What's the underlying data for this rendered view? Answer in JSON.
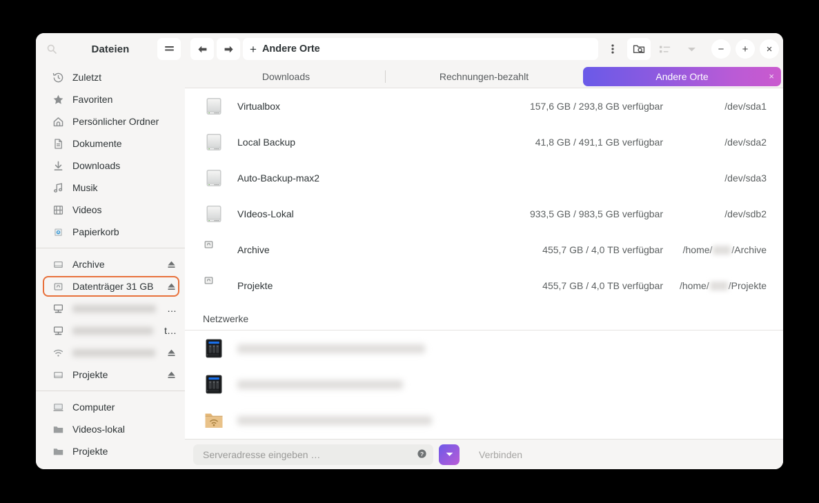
{
  "app": {
    "title": "Dateien",
    "search_icon": "search-icon",
    "menu_icon": "hamburger-menu-icon"
  },
  "toolbar": {
    "back_icon": "arrow-left-icon",
    "forward_icon": "arrow-right-icon",
    "path_plus": "+",
    "path_label": "Andere Orte",
    "kebab_icon": "vertical-dots-icon",
    "folder_search_icon": "folder-search-icon",
    "list_view_icon": "list-view-icon",
    "view_dropdown_icon": "chevron-down-icon",
    "minimize_label": "−",
    "maximize_label": "+",
    "close_label": "×"
  },
  "tabs": [
    {
      "label": "Downloads",
      "active": false
    },
    {
      "label": "Rechnungen-bezahlt",
      "active": false
    },
    {
      "label": "Andere Orte",
      "active": true,
      "close_label": "×"
    }
  ],
  "sidebar": {
    "groups": [
      {
        "items": [
          {
            "label": "Zuletzt",
            "icon": "history-icon"
          },
          {
            "label": "Favoriten",
            "icon": "star-icon"
          },
          {
            "label": "Persönlicher Ordner",
            "icon": "home-icon"
          },
          {
            "label": "Dokumente",
            "icon": "document-icon"
          },
          {
            "label": "Downloads",
            "icon": "download-icon"
          },
          {
            "label": "Musik",
            "icon": "music-note-icon"
          },
          {
            "label": "Videos",
            "icon": "film-icon"
          },
          {
            "label": "Papierkorb",
            "icon": "trash-icon"
          }
        ]
      },
      {
        "items": [
          {
            "label": "Archive",
            "icon": "drive-icon",
            "eject": true
          },
          {
            "label": "Datenträger 31 GB",
            "icon": "removable-drive-icon",
            "eject": true,
            "highlighted": true
          },
          {
            "label": "",
            "icon": "server-icon",
            "blurred": true,
            "tail": "…"
          },
          {
            "label": "",
            "icon": "server-icon",
            "blurred": true,
            "tail": "t…"
          },
          {
            "label": "",
            "icon": "wifi-icon",
            "blurred": true,
            "eject": true
          },
          {
            "label": "Projekte",
            "icon": "drive-icon",
            "eject": true
          }
        ]
      },
      {
        "items": [
          {
            "label": "Computer",
            "icon": "computer-icon"
          },
          {
            "label": "Videos-lokal",
            "icon": "folder-icon"
          },
          {
            "label": "Projekte",
            "icon": "folder-icon"
          }
        ]
      }
    ]
  },
  "main": {
    "drives": [
      {
        "name": "Virtualbox",
        "icon": "hard-drive-icon",
        "size": "157,6 GB / 293,8 GB verfügbar",
        "device": "/dev/sda1"
      },
      {
        "name": "Local Backup",
        "icon": "hard-drive-icon",
        "size": "41,8 GB / 491,1 GB verfügbar",
        "device": "/dev/sda2"
      },
      {
        "name": "Auto-Backup-max2",
        "icon": "hard-drive-icon",
        "size": "",
        "device": "/dev/sda3"
      },
      {
        "name": "VIdeos-Lokal",
        "icon": "hard-drive-icon",
        "size": "933,5 GB / 983,5 GB verfügbar",
        "device": "/dev/sdb2"
      },
      {
        "name": "Archive",
        "icon": "removable-drive-icon",
        "size": "455,7 GB / 4,0 TB verfügbar",
        "device_prefix": "/home/",
        "device_suffix": "/Archive",
        "device_blurred": true
      },
      {
        "name": "Projekte",
        "icon": "removable-drive-icon",
        "size": "455,7 GB / 4,0 TB verfügbar",
        "device_prefix": "/home/",
        "device_suffix": "/Projekte",
        "device_blurred": true
      }
    ],
    "network_section_label": "Netzwerke",
    "networks": [
      {
        "name": "",
        "icon": "nas-icon",
        "blurred": true,
        "blur_width": 272
      },
      {
        "name": "",
        "icon": "nas-icon",
        "blurred": true,
        "blur_width": 240
      },
      {
        "name": "",
        "icon": "network-folder-icon",
        "blurred": true,
        "blur_width": 282
      }
    ]
  },
  "connect_bar": {
    "address_value": "",
    "address_placeholder": "Serveradresse eingeben …",
    "help_icon": "help-icon",
    "dropdown_icon": "chevron-down-icon",
    "connect_label": "Verbinden"
  },
  "colors": {
    "tab_gradient_start": "#6a5ae8",
    "tab_gradient_end": "#ca5ace",
    "highlight_border": "#e8703a",
    "chrome_bg": "#f6f5f4"
  }
}
